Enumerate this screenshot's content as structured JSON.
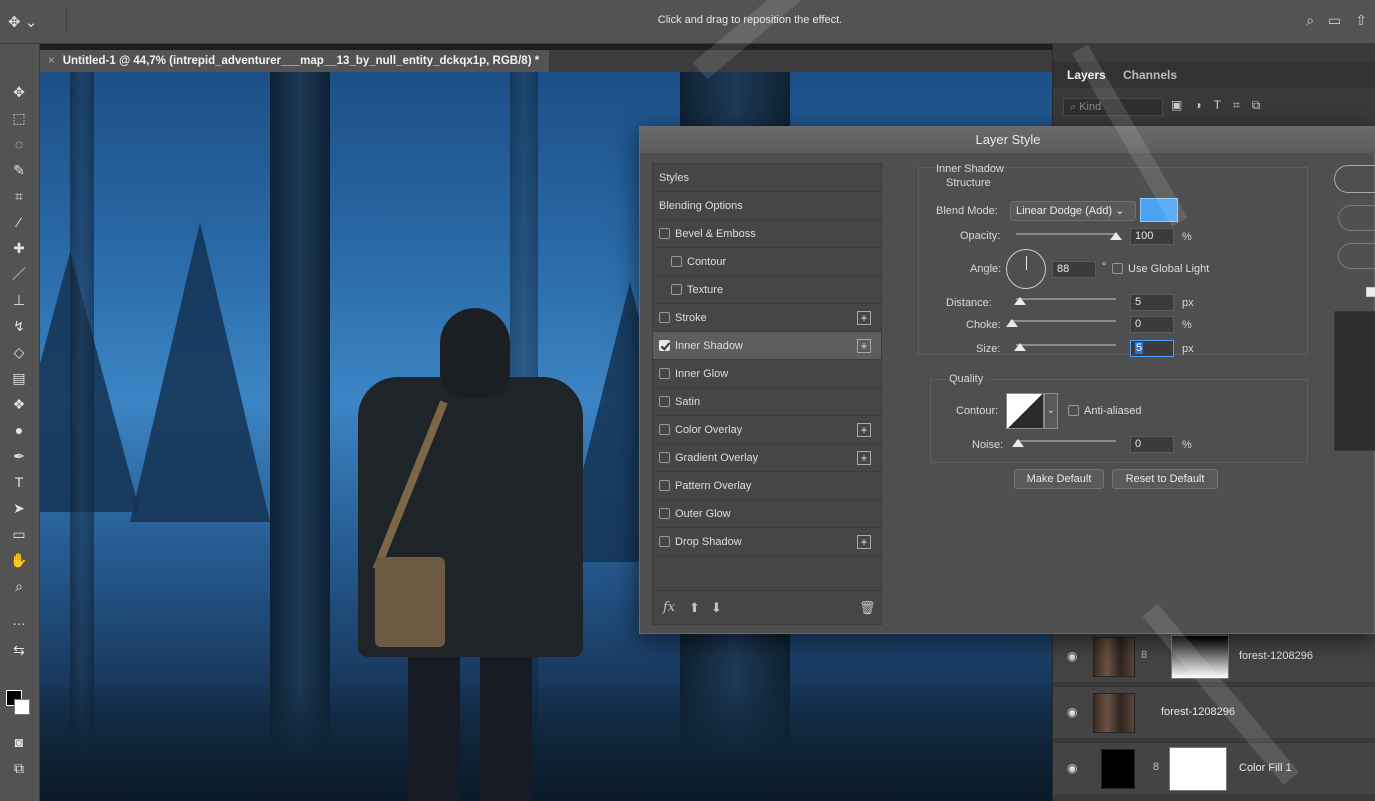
{
  "optionsBar": {
    "hint": "Click and drag to reposition the effect.",
    "move_icon": "move-tool-icon"
  },
  "document": {
    "tab_title": "Untitled-1 @ 44,7% (intrepid_adventurer___map__13_by_null_entity_dckqx1p, RGB/8) *",
    "close_glyph": "×"
  },
  "layersPanel": {
    "tabs": [
      "Layers",
      "Channels"
    ],
    "kind_placeholder": "Kind",
    "layers": [
      {
        "name": "forest-1208296",
        "has_mask": true
      },
      {
        "name": "forest-1208296",
        "has_mask": false
      },
      {
        "name": "Color Fill 1",
        "has_mask": true
      }
    ]
  },
  "dialog": {
    "title": "Layer Style",
    "styles": [
      {
        "label": "Styles",
        "checkbox": false,
        "checked": false,
        "plus": false
      },
      {
        "label": "Blending Options",
        "checkbox": false,
        "checked": false,
        "plus": false
      },
      {
        "label": "Bevel & Emboss",
        "checkbox": true,
        "checked": false,
        "plus": false
      },
      {
        "label": "Contour",
        "checkbox": true,
        "checked": false,
        "plus": false
      },
      {
        "label": "Texture",
        "checkbox": true,
        "checked": false,
        "plus": false
      },
      {
        "label": "Stroke",
        "checkbox": true,
        "checked": false,
        "plus": true
      },
      {
        "label": "Inner Shadow",
        "checkbox": true,
        "checked": true,
        "plus": true
      },
      {
        "label": "Inner Glow",
        "checkbox": true,
        "checked": false,
        "plus": false
      },
      {
        "label": "Satin",
        "checkbox": true,
        "checked": false,
        "plus": false
      },
      {
        "label": "Color Overlay",
        "checkbox": true,
        "checked": false,
        "plus": true
      },
      {
        "label": "Gradient Overlay",
        "checkbox": true,
        "checked": false,
        "plus": true
      },
      {
        "label": "Pattern Overlay",
        "checkbox": true,
        "checked": false,
        "plus": false
      },
      {
        "label": "Outer Glow",
        "checkbox": true,
        "checked": false,
        "plus": false
      },
      {
        "label": "Drop Shadow",
        "checkbox": true,
        "checked": false,
        "plus": true
      }
    ],
    "footer": {
      "fx": "fx",
      "up": "⬆",
      "down": "⬇",
      "trash": "🗑"
    },
    "inner_shadow": {
      "section_title": "Inner Shadow",
      "structure_label": "Structure",
      "blend_mode_label": "Blend Mode:",
      "blend_mode_value": "Linear Dodge (Add)",
      "blend_color": "#4aa3f0",
      "opacity_label": "Opacity:",
      "opacity_value": "100",
      "opacity_unit": "%",
      "angle_label": "Angle:",
      "angle_value": "88",
      "angle_unit": "°",
      "global_light_label": "Use Global Light",
      "distance_label": "Distance:",
      "distance_value": "5",
      "distance_unit": "px",
      "choke_label": "Choke:",
      "choke_value": "0",
      "choke_unit": "%",
      "size_label": "Size:",
      "size_value": "5",
      "size_unit": "px",
      "quality_label": "Quality",
      "contour_label": "Contour:",
      "anti_aliased_label": "Anti-aliased",
      "noise_label": "Noise:",
      "noise_value": "0",
      "noise_unit": "%",
      "make_default": "Make Default",
      "reset_default": "Reset to Default"
    }
  }
}
